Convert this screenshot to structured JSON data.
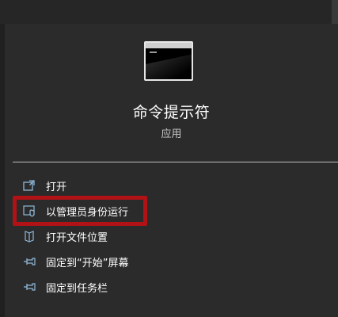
{
  "app": {
    "icon": "command-prompt-icon",
    "title": "命令提示符",
    "subtitle": "应用"
  },
  "menu": {
    "items": [
      {
        "icon": "open-icon",
        "label": "打开"
      },
      {
        "icon": "shield-admin-icon",
        "label": "以管理员身份运行"
      },
      {
        "icon": "open-file-location-icon",
        "label": "打开文件位置"
      },
      {
        "icon": "pin-icon",
        "label": "固定到“开始”屏幕"
      },
      {
        "icon": "pin-icon",
        "label": "固定到任务栏"
      }
    ]
  },
  "colors": {
    "panel": "#2b2b2b",
    "background": "#1b1b1b",
    "accent_icon": "#8fb8d8",
    "highlight": "#b01216",
    "text": "#ffffff",
    "subtext": "#c8c8c8"
  }
}
